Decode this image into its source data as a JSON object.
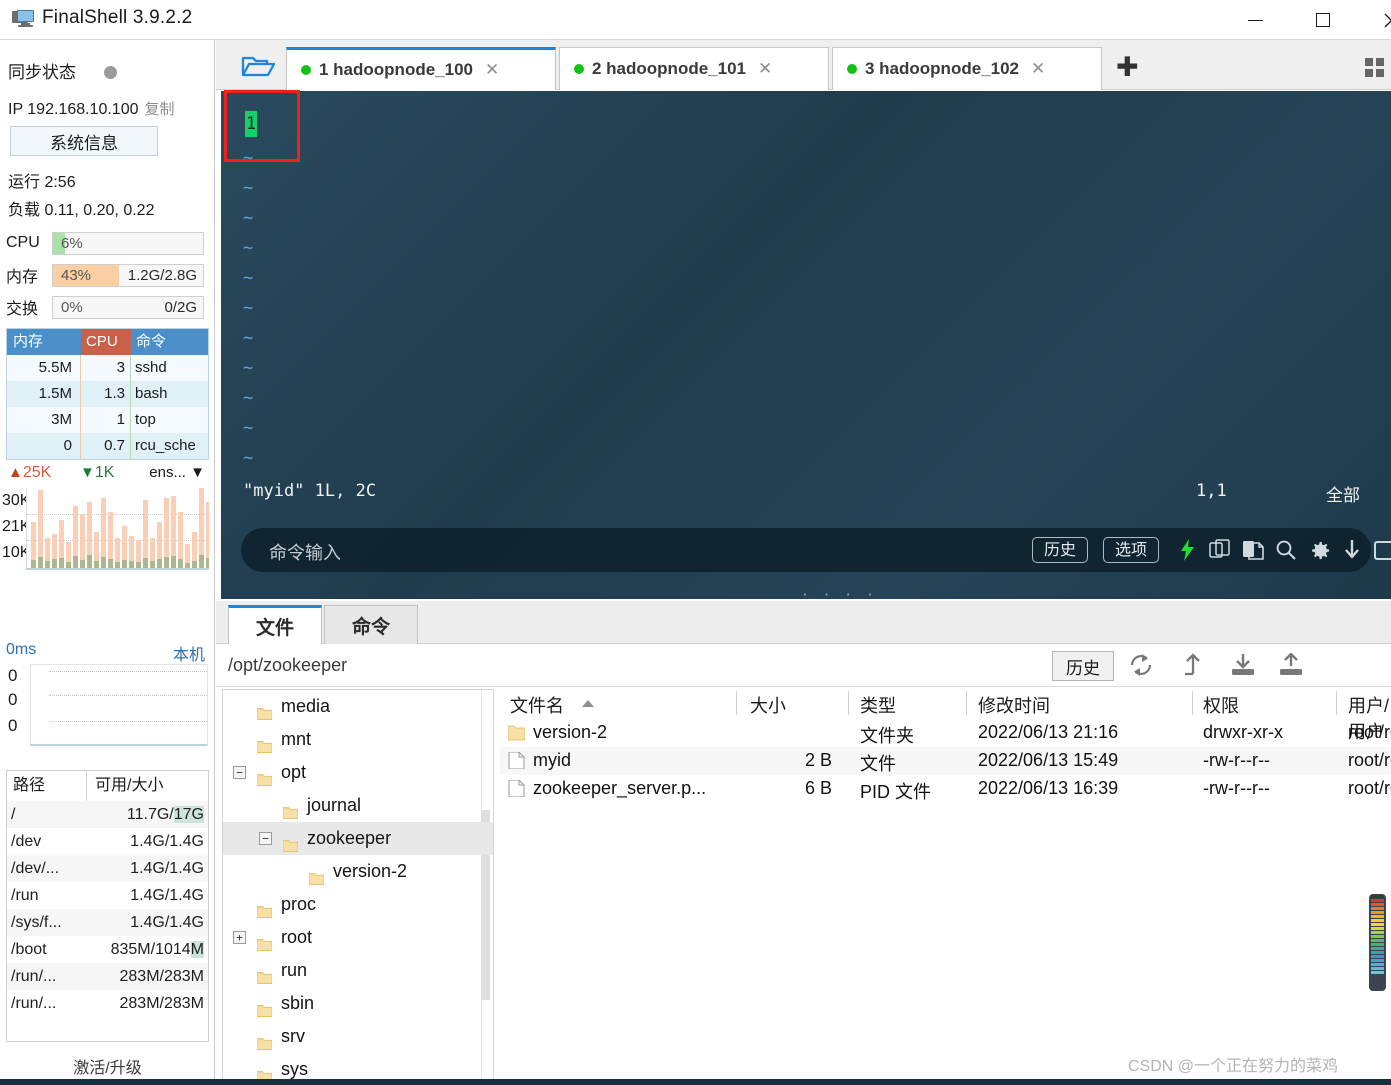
{
  "window": {
    "title": "FinalShell 3.9.2.2",
    "minimize": "—",
    "maximize": "□",
    "close": "✕"
  },
  "sidebar": {
    "sync_label": "同步状态",
    "ip_label": "IP 192.168.10.100",
    "copy_label": "复制",
    "sysinfo_button": "系统信息",
    "uptime": "运行 2:56",
    "loadavg": "负载 0.11, 0.20, 0.22",
    "meters": [
      {
        "name": "CPU",
        "percent": "6%",
        "right": "",
        "fill_pct": 8,
        "color": "#a9e2a9"
      },
      {
        "name": "内存",
        "percent": "43%",
        "right": "1.2G/2.8G",
        "fill_pct": 44,
        "color": "#fbcfa4"
      },
      {
        "name": "交换",
        "percent": "0%",
        "right": "0/2G",
        "fill_pct": 0,
        "color": "#dddddd"
      }
    ],
    "process_table": {
      "headers": [
        "内存",
        "CPU",
        "命令"
      ],
      "rows": [
        {
          "mem": "5.5M",
          "cpu": "3",
          "cmd": "sshd"
        },
        {
          "mem": "1.5M",
          "cpu": "1.3",
          "cmd": "bash"
        },
        {
          "mem": "3M",
          "cpu": "1",
          "cmd": "top"
        },
        {
          "mem": "0",
          "cpu": "0.7",
          "cmd": "rcu_sche"
        }
      ]
    },
    "network": {
      "upload": "25K",
      "download": "1K",
      "interface": "ens...",
      "y_labels": [
        "30K",
        "21K",
        "10K"
      ]
    },
    "latency": {
      "value": "0ms",
      "host": "本机",
      "y_labels": [
        "0",
        "0",
        "0"
      ]
    },
    "disk_table": {
      "headers": [
        "路径",
        "可用/大小"
      ],
      "rows": [
        {
          "path": "/",
          "size": "11.7G/17G",
          "hl_from": 6
        },
        {
          "path": "/dev",
          "size": "1.4G/1.4G",
          "hl_from": -1
        },
        {
          "path": "/dev/...",
          "size": "1.4G/1.4G",
          "hl_from": -1
        },
        {
          "path": "/run",
          "size": "1.4G/1.4G",
          "hl_from": -1
        },
        {
          "path": "/sys/f...",
          "size": "1.4G/1.4G",
          "hl_from": -1
        },
        {
          "path": "/boot",
          "size": "835M/1014M",
          "hl_from": 9
        },
        {
          "path": "/run/...",
          "size": "283M/283M",
          "hl_from": -1
        },
        {
          "path": "/run/...",
          "size": "283M/283M",
          "hl_from": -1
        }
      ]
    },
    "activate_label": "激活/升级"
  },
  "tabbar": {
    "folder_icon": "open-folder-icon",
    "tabs": [
      {
        "label": "1 hadoopnode_100",
        "close": "✕",
        "active": true
      },
      {
        "label": "2 hadoopnode_101",
        "close": "✕",
        "active": false
      },
      {
        "label": "3 hadoopnode_102",
        "close": "✕",
        "active": false
      }
    ],
    "add_label": "✚",
    "grid_icon": "grid-view-icon"
  },
  "terminal": {
    "cursor_char": "1",
    "tilde": "~",
    "tilde_count": 11,
    "status_left": "\"myid\" 1L, 2C",
    "status_pos": "1,1",
    "status_all": "全部",
    "command_placeholder": "命令输入",
    "history_pill": "历史",
    "options_pill": "选项",
    "icons": [
      "lightning-icon",
      "copy-icon",
      "paste-icon",
      "search-icon",
      "gear-icon",
      "download-icon",
      "window-icon"
    ],
    "drag_dots": "· · · ·"
  },
  "filemanager": {
    "tabs": [
      {
        "label": "文件",
        "active": true
      },
      {
        "label": "命令",
        "active": false
      }
    ],
    "path": "/opt/zookeeper",
    "history_button": "历史",
    "toolbar_icons": [
      "refresh-icon",
      "up-arrow-icon",
      "download-icon",
      "upload-icon"
    ],
    "tree": [
      {
        "label": "media",
        "depth": 1,
        "toggle": "",
        "selected": false
      },
      {
        "label": "mnt",
        "depth": 1,
        "toggle": "",
        "selected": false
      },
      {
        "label": "opt",
        "depth": 1,
        "toggle": "−",
        "selected": false
      },
      {
        "label": "journal",
        "depth": 2,
        "toggle": "",
        "selected": false
      },
      {
        "label": "zookeeper",
        "depth": 2,
        "toggle": "−",
        "selected": true
      },
      {
        "label": "version-2",
        "depth": 3,
        "toggle": "",
        "selected": false
      },
      {
        "label": "proc",
        "depth": 1,
        "toggle": "",
        "selected": false
      },
      {
        "label": "root",
        "depth": 1,
        "toggle": "+",
        "selected": false
      },
      {
        "label": "run",
        "depth": 1,
        "toggle": "",
        "selected": false
      },
      {
        "label": "sbin",
        "depth": 1,
        "toggle": "",
        "selected": false
      },
      {
        "label": "srv",
        "depth": 1,
        "toggle": "",
        "selected": false
      },
      {
        "label": "sys",
        "depth": 1,
        "toggle": "",
        "selected": false
      }
    ],
    "columns": [
      "文件名",
      "大小",
      "类型",
      "修改时间",
      "权限",
      "用户/用户"
    ],
    "sort_column": "文件名",
    "sort_dir": "asc",
    "files": [
      {
        "name": "version-2",
        "size": "",
        "type": "文件夹",
        "mtime": "2022/06/13 21:16",
        "perm": "drwxr-xr-x",
        "owner": "root/ro",
        "icon": "folder-icon"
      },
      {
        "name": "myid",
        "size": "2 B",
        "type": "文件",
        "mtime": "2022/06/13 15:49",
        "perm": "-rw-r--r--",
        "owner": "root/ro",
        "icon": "file-icon"
      },
      {
        "name": "zookeeper_server.p...",
        "size": "6 B",
        "type": "PID 文件",
        "mtime": "2022/06/13 16:39",
        "perm": "-rw-r--r--",
        "owner": "root/ro",
        "icon": "file-icon"
      }
    ]
  },
  "watermark": "CSDN @一个正在努力的菜鸡",
  "colors": {
    "accent_blue": "#1a86e0",
    "status_green": "#13c213",
    "header_blue": "#4a8fc9",
    "header_red": "#c8604a",
    "terminal_bg": "#24455a",
    "highlight_red": "#f02020"
  }
}
